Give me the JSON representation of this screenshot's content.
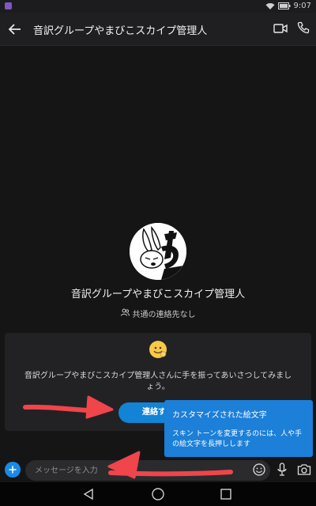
{
  "status_bar": {
    "time": "9:07"
  },
  "header": {
    "title": "音訳グループやまびこスカイプ管理人",
    "back_icon": "arrow-left-icon",
    "video_icon": "video-call-icon",
    "call_icon": "phone-icon"
  },
  "profile": {
    "name": "音訳グループやまびこスカイプ管理人",
    "shared_contacts": "共通の連絡先なし"
  },
  "greeting_card": {
    "message": "音訳グループやまびこスカイプ管理人さんに手を振ってあいさつしてみましょう。",
    "button_label": "連絡す"
  },
  "tooltip": {
    "title": "カスタマイズされた絵文字",
    "body": "スキン トーンを変更するのには、人や手の絵文字を長押しします"
  },
  "composer": {
    "placeholder": "メッセージを入力"
  },
  "colors": {
    "accent": "#1383d6",
    "tooltip": "#1c7fd8",
    "annotation": "#f0454b"
  }
}
